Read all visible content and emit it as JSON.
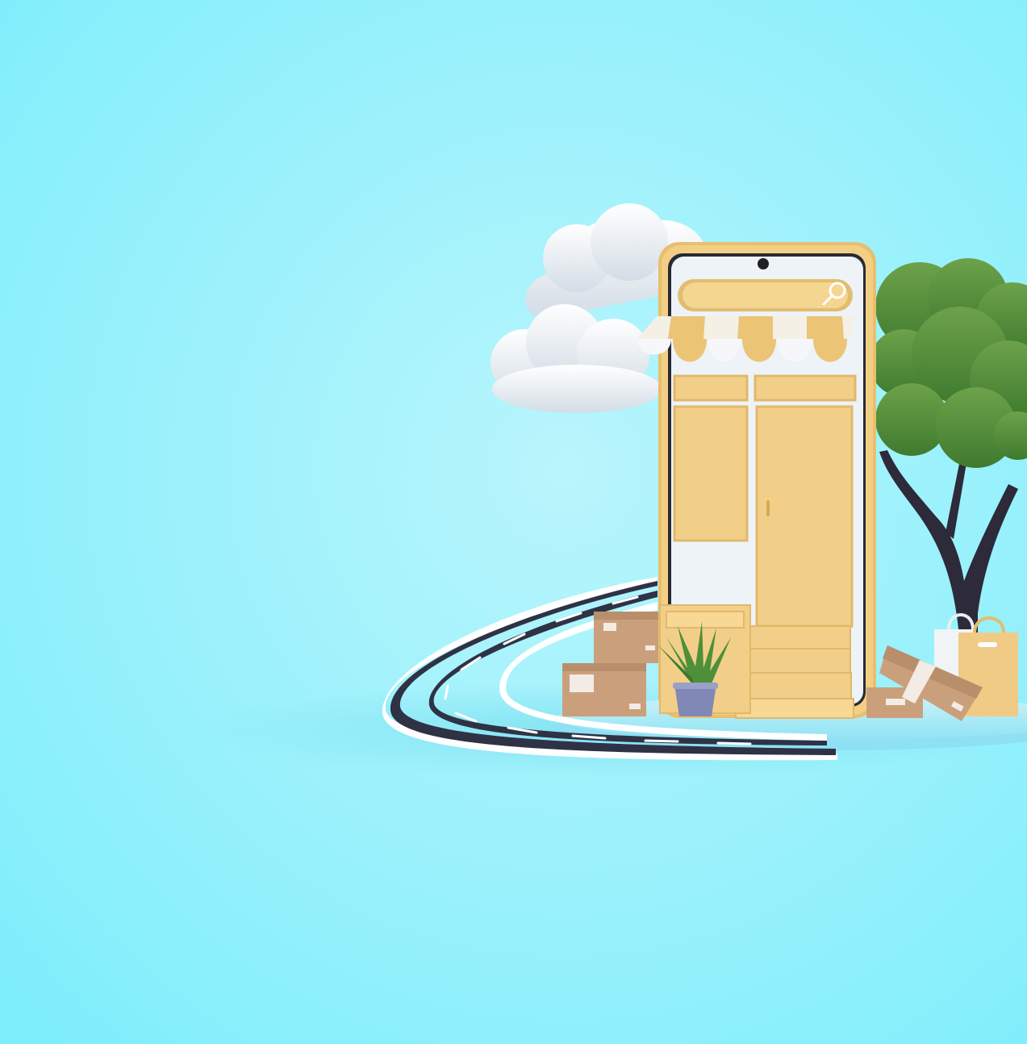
{
  "scene": {
    "subject": "",
    "colors": {
      "background_center": "#b8f4fc",
      "background_edge": "#7eeefb",
      "phone_frame": "#f3cf85",
      "phone_screen": "#eef3f8",
      "road": "#2f3245",
      "road_edge": "#ffffff",
      "tree_leaves": "#5a8f3c",
      "tree_trunk": "#2d2a3a",
      "box": "#caa07c",
      "cloud": "#eef3f7"
    },
    "icons": [
      "search-icon",
      "camera-icon",
      "cloud-icon",
      "tree-icon",
      "plant-icon",
      "box-icon",
      "shopping-bag-icon"
    ]
  }
}
